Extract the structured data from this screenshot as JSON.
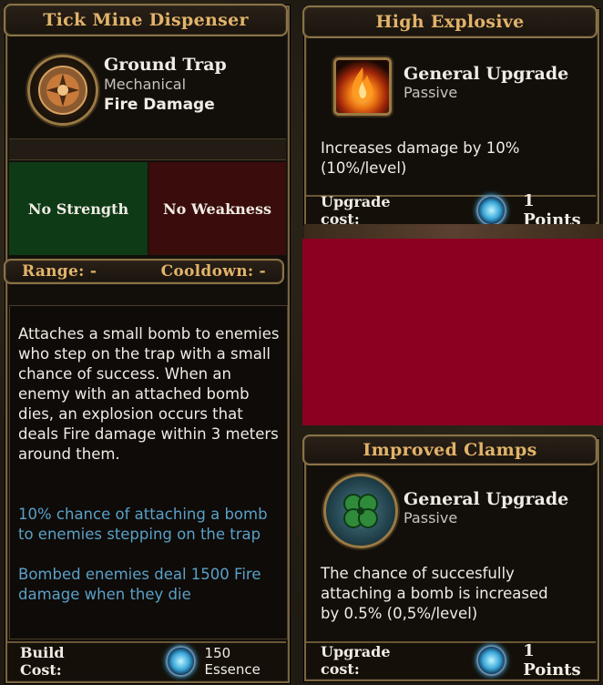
{
  "left": {
    "title": "Tick Mine Dispenser",
    "trap_type": "Ground Trap",
    "category": "Mechanical",
    "damage_type": "Fire Damage",
    "strength": "No Strength",
    "weakness": "No Weakness",
    "range_label": "Range: -",
    "cooldown_label": "Cooldown: -",
    "description": "Attaches a small bomb to enemies who step on the trap with a small chance of success. When an enemy with an attached bomb dies, an explosion occurs that deals Fire damage within 3 meters around them.",
    "bonus_1": "10% chance of attaching a bomb to enemies stepping on the trap",
    "bonus_2": "Bombed enemies deal 1500 Fire damage when they die",
    "build_cost_label": "Build Cost:",
    "build_cost_value": "150 Essence"
  },
  "upgrade_1": {
    "title": "High Explosive",
    "type": "General Upgrade",
    "subtype": "Passive",
    "description": "Increases damage by 10% (10%/level)",
    "cost_label": "Upgrade cost:",
    "cost_value": "1 Points",
    "icon": "fire-icon"
  },
  "upgrade_2": {
    "title": "Improved Clamps",
    "type": "General Upgrade",
    "subtype": "Passive",
    "description": "The chance of succesfully attaching a bomb is increased by 0.5% (0,5%/level)",
    "cost_label": "Upgrade cost:",
    "cost_value": "1 Points",
    "icon": "clover-icon"
  },
  "colors": {
    "title_gold": "#e2b36a",
    "strength_bg": "#0f3a16",
    "weakness_bg": "#3a0c0c",
    "redacted": "#8b0020",
    "bonus_blue": "#5aa0c8"
  }
}
